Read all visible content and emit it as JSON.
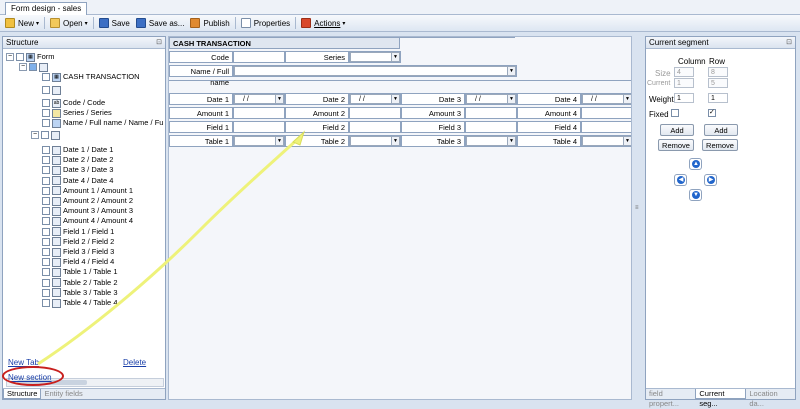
{
  "window": {
    "tab_title": "Form design - sales"
  },
  "toolbar": {
    "new": "New",
    "open": "Open",
    "save": "Save",
    "save_as": "Save as...",
    "publish": "Publish",
    "properties": "Properties",
    "actions": "Actions"
  },
  "structure": {
    "title": "Structure",
    "nodes": {
      "form": "Form",
      "cash_transaction": "CASH TRANSACTION",
      "code": "Code / Code",
      "series": "Series / Series",
      "name": "Name / Full name / Name / Full"
    },
    "items": [
      "Date 1 / Date 1",
      "Date 2 / Date 2",
      "Date 3 / Date 3",
      "Date 4 / Date 4",
      "Amount 1 / Amount 1",
      "Amount 2 / Amount 2",
      "Amount 3 / Amount 3",
      "Amount 4 / Amount 4",
      "Field 1 / Field 1",
      "Field 2 / Field 2",
      "Field 3 / Field 3",
      "Field 4 / Field 4",
      "Table 1 / Table 1",
      "Table 2 / Table 2",
      "Table 3 / Table 3",
      "Table 4 / Table 4"
    ],
    "item_icons": [
      "calendar-icon",
      "calendar-icon",
      "calendar-icon",
      "calendar-icon",
      "amount-icon",
      "amount-icon",
      "amount-icon",
      "amount-icon",
      "text-field-icon",
      "text-field-icon",
      "text-field-icon",
      "text-field-icon",
      "table-icon",
      "table-icon",
      "table-icon",
      "table-icon"
    ],
    "new_tab": "New Tab",
    "delete": "Delete",
    "new_section": "New section",
    "tabs": [
      "Structure",
      "Entity fields"
    ]
  },
  "form": {
    "header": "CASH TRANSACTION",
    "code_label": "Code",
    "series_label": "Series",
    "name_label": "Name / Full name",
    "date_value": "/ /",
    "dates": [
      "Date 1",
      "Date 2",
      "Date 3",
      "Date 4"
    ],
    "amounts": [
      "Amount 1",
      "Amount 2",
      "Amount 3",
      "Amount 4"
    ],
    "fields": [
      "Field 1",
      "Field 2",
      "Field 3",
      "Field 4"
    ],
    "tables": [
      "Table 1",
      "Table 2",
      "Table 3",
      "Table 4"
    ]
  },
  "segment": {
    "title": "Current segment",
    "column": "Column",
    "row": "Row",
    "size": "Size",
    "current": "Current",
    "size_col": "4",
    "size_row": "8",
    "current_col": "1",
    "current_row": "5",
    "weight": "Weight",
    "weight_col": "1",
    "weight_row": "1",
    "fixed": "Fixed",
    "add": "Add",
    "remove": "Remove",
    "tabs": [
      "field propert...",
      "Current seg...",
      "Location da..."
    ]
  },
  "colors": {
    "accent": "#2266cc",
    "arrow": "#eef27a",
    "highlight": "#c8201e"
  }
}
